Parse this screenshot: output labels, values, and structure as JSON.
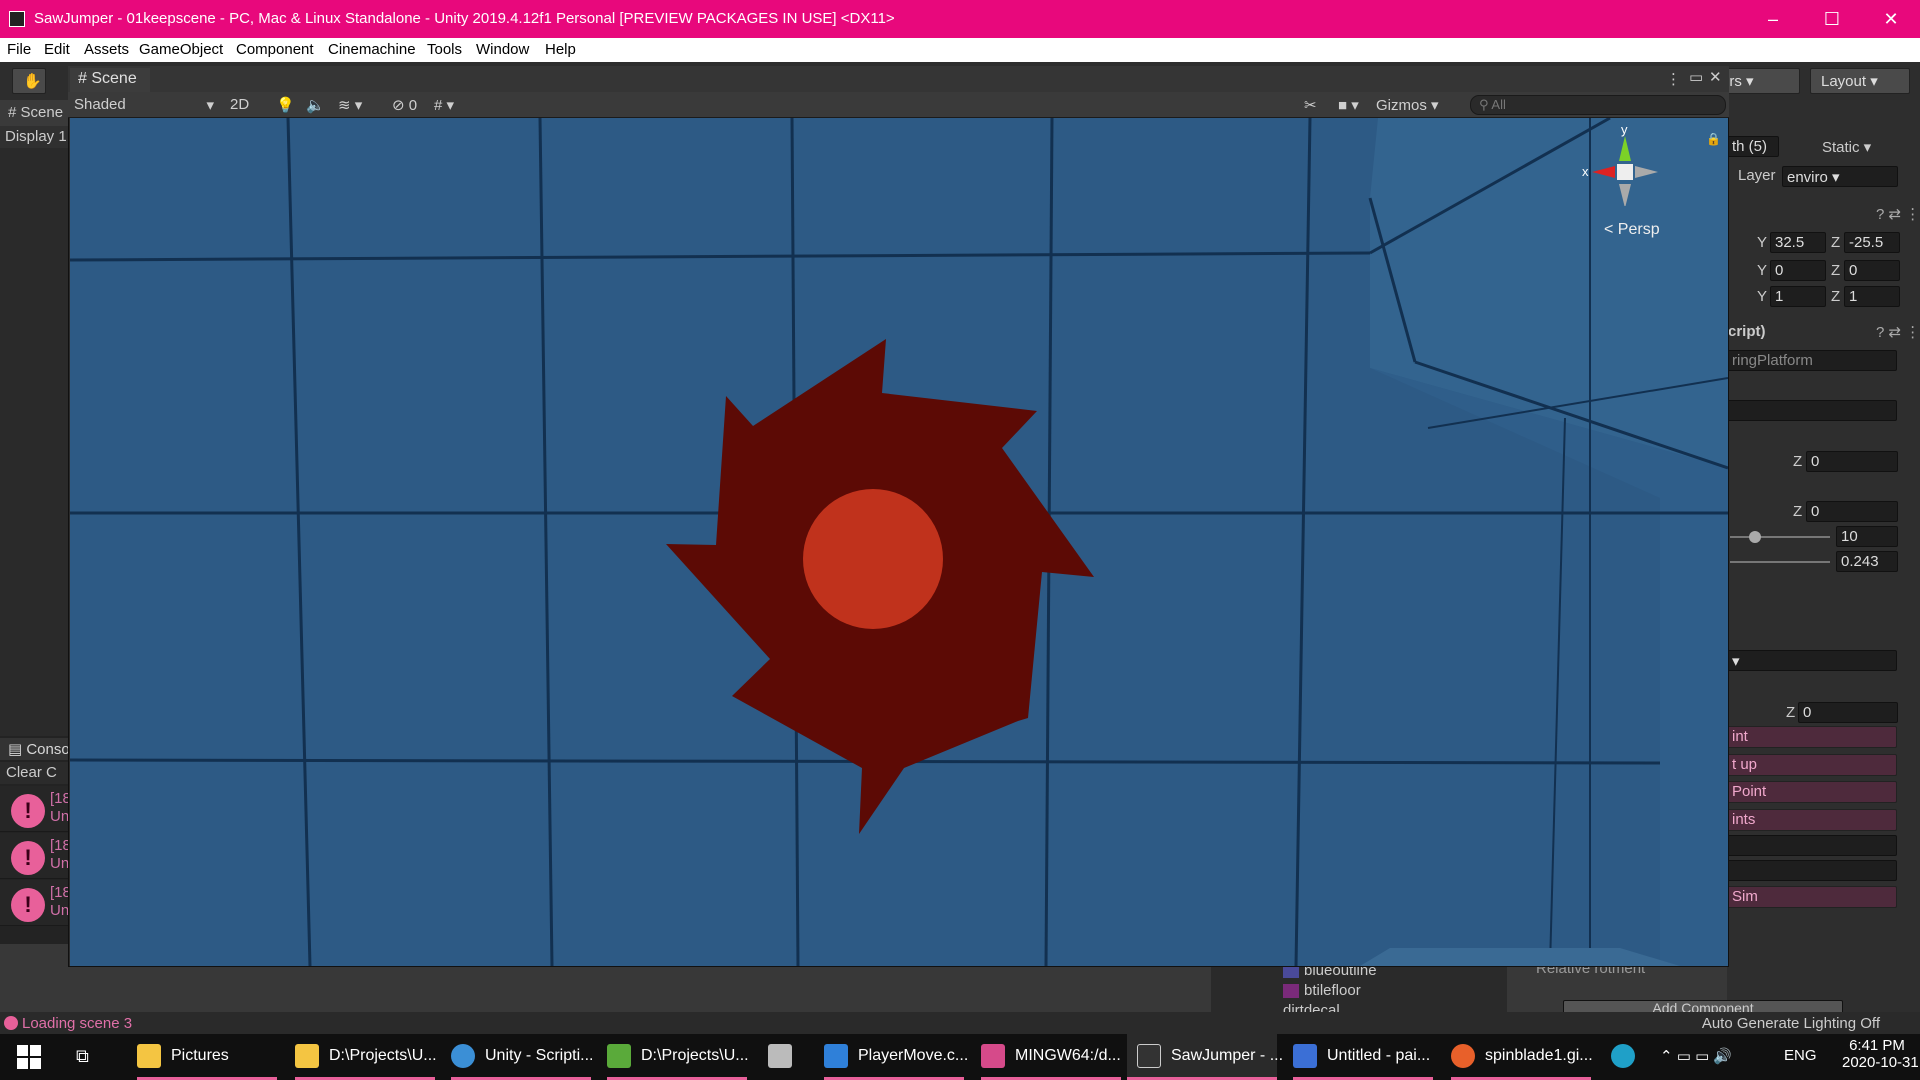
{
  "window": {
    "title": "SawJumper - 01keepscene - PC, Mac & Linux Standalone - Unity 2019.4.12f1 Personal [PREVIEW PACKAGES IN USE] <DX11>",
    "controls": {
      "minimize": "–",
      "maximize": "☐",
      "close": "✕"
    }
  },
  "menu": [
    "File",
    "Edit",
    "Assets",
    "GameObject",
    "Component",
    "Cinemachine",
    "Tools",
    "Window",
    "Help"
  ],
  "main_toolbar": {
    "layers_label": "ers",
    "layout_label": "Layout"
  },
  "left_panel": {
    "tab": "Scene",
    "display": "Display 1"
  },
  "console": {
    "tab": "Console",
    "toolbar": "Clear C",
    "rows": [
      {
        "line1": "[18",
        "line2": "Un"
      },
      {
        "line1": "[18",
        "line2": "Un"
      },
      {
        "line1": "[18",
        "line2": "Un"
      }
    ]
  },
  "scene": {
    "tab": "Scene",
    "shading": "Shaded",
    "mode_2d": "2D",
    "hidden_count": "0",
    "gizmos": "Gizmos",
    "search_placeholder": "All",
    "axis_y": "y",
    "axis_x": "x",
    "persp": "Persp"
  },
  "inspector": {
    "name": "th (5)",
    "static": "Static",
    "layer_label": "Layer",
    "layer_value": "enviro",
    "pos_y_label": "Y",
    "pos_y": "32.5",
    "pos_z_label": "Z",
    "pos_z": "-25.5",
    "rot_y": "0",
    "rot_z": "0",
    "scale_y": "1",
    "scale_z": "1",
    "script_header": "cript)",
    "script_ref": "ringPlatform",
    "field_z1": "0",
    "field_z2": "0",
    "slider_value": "10",
    "value_0243": "0.243",
    "field_z3": "0",
    "btn_point": "int",
    "btn_setup": "t up",
    "btn_addpoint": "Point",
    "btn_points": "ints",
    "btn_sim": "Sim",
    "relative": "Relative rotment",
    "add_component": "Add Component"
  },
  "project_list": [
    "blueoutline",
    "btilefloor",
    "dirtdecal"
  ],
  "status": {
    "message": "Loading scene 3",
    "right": "Auto Generate Lighting Off"
  },
  "taskbar": {
    "items": [
      {
        "label": "Pictures",
        "color": "#f4c542"
      },
      {
        "label": "D:\\Projects\\U...",
        "color": "#f4c542"
      },
      {
        "label": "Unity - Scripti...",
        "color": "#3b8fd6"
      },
      {
        "label": "D:\\Projects\\U...",
        "color": "#5aaa3a"
      },
      {
        "label": "PlayerMove.c...",
        "color": "#2f80d9"
      },
      {
        "label": "MINGW64:/d...",
        "color": "#d64a8a"
      },
      {
        "label": "SawJumper - ...",
        "color": "#333333"
      },
      {
        "label": "Untitled - pai...",
        "color": "#3b6fd6"
      },
      {
        "label": "spinblade1.gi...",
        "color": "#e8602a"
      }
    ],
    "lang": "ENG",
    "time": "6:41 PM",
    "date": "2020-10-31"
  },
  "colors": {
    "title_bar": "#e8087c",
    "viewport_bg": "#2d5a85",
    "saw_blade": "#5c0a05",
    "saw_center": "#c0321c",
    "accent_pink": "#e8609a"
  }
}
